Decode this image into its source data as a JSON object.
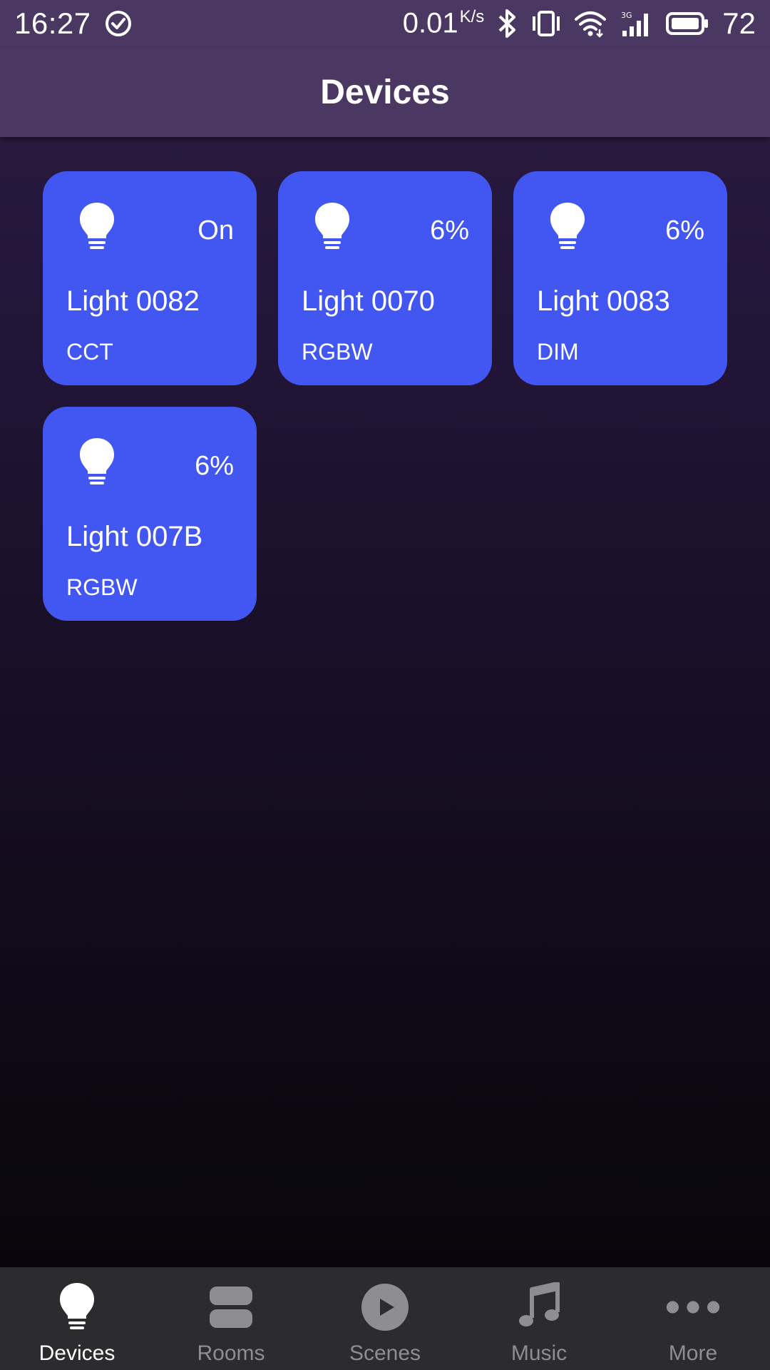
{
  "status_bar": {
    "time": "16:27",
    "net_speed": "0.01",
    "net_speed_unit": "K/s",
    "network_type": "3G",
    "battery": "72"
  },
  "app_bar": {
    "title": "Devices"
  },
  "devices": [
    {
      "status": "On",
      "name": "Light 0082",
      "type": "CCT"
    },
    {
      "status": "6%",
      "name": "Light 0070",
      "type": "RGBW"
    },
    {
      "status": "6%",
      "name": "Light 0083",
      "type": "DIM"
    },
    {
      "status": "6%",
      "name": "Light 007B",
      "type": "RGBW"
    }
  ],
  "bottom_nav": {
    "items": [
      {
        "label": "Devices",
        "icon": "bulb-icon",
        "active": true
      },
      {
        "label": "Rooms",
        "icon": "rooms-icon",
        "active": false
      },
      {
        "label": "Scenes",
        "icon": "play-icon",
        "active": false
      },
      {
        "label": "Music",
        "icon": "music-note-icon",
        "active": false
      },
      {
        "label": "More",
        "icon": "more-dots-icon",
        "active": false
      }
    ]
  },
  "colors": {
    "card": "#4257f2",
    "bar": "#4a3862",
    "nav_bg": "#2c2b2e",
    "nav_inactive": "#8e8d92"
  }
}
